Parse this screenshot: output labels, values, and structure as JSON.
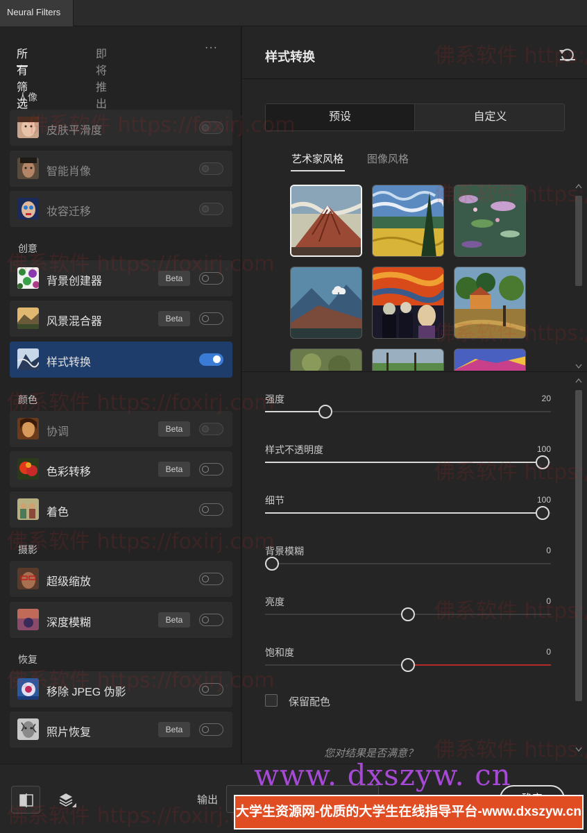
{
  "window": {
    "tab_title": "Neural Filters"
  },
  "left_panel": {
    "tabs": [
      {
        "label": "所有筛选器",
        "active": true
      },
      {
        "label": "即将推出",
        "active": false
      }
    ],
    "more": "···",
    "categories": [
      {
        "label": "人像",
        "filters": [
          {
            "name": "皮肤平滑度",
            "beta": false,
            "enabled": false,
            "available": false
          },
          {
            "name": "智能肖像",
            "beta": false,
            "enabled": false,
            "available": false
          },
          {
            "name": "妆容迁移",
            "beta": false,
            "enabled": false,
            "available": false
          }
        ]
      },
      {
        "label": "创意",
        "filters": [
          {
            "name": "背景创建器",
            "beta": true,
            "enabled": false,
            "available": true
          },
          {
            "name": "风景混合器",
            "beta": true,
            "enabled": false,
            "available": true
          },
          {
            "name": "样式转换",
            "beta": false,
            "enabled": true,
            "available": true,
            "selected": true
          }
        ]
      },
      {
        "label": "颜色",
        "filters": [
          {
            "name": "协调",
            "beta": true,
            "enabled": false,
            "available": false
          },
          {
            "name": "色彩转移",
            "beta": true,
            "enabled": false,
            "available": true
          },
          {
            "name": "着色",
            "beta": false,
            "enabled": false,
            "available": true
          }
        ]
      },
      {
        "label": "摄影",
        "filters": [
          {
            "name": "超级缩放",
            "beta": false,
            "enabled": false,
            "available": true
          },
          {
            "name": "深度模糊",
            "beta": true,
            "enabled": false,
            "available": true
          }
        ]
      },
      {
        "label": "恢复",
        "filters": [
          {
            "name": "移除 JPEG 伪影",
            "beta": false,
            "enabled": false,
            "available": true
          },
          {
            "name": "照片恢复",
            "beta": true,
            "enabled": false,
            "available": true
          }
        ]
      }
    ],
    "beta_label": "Beta"
  },
  "right_panel": {
    "title": "样式转换",
    "reset_icon": "reset-icon",
    "segment": {
      "preset": "预设",
      "custom": "自定义",
      "active": "preset"
    },
    "style_tabs": [
      {
        "label": "艺术家风格",
        "active": true
      },
      {
        "label": "图像风格",
        "active": false
      }
    ],
    "sliders": [
      {
        "label": "强度",
        "value": "20",
        "fraction": 0.21
      },
      {
        "label": "样式不透明度",
        "value": "100",
        "fraction": 0.97
      },
      {
        "label": "细节",
        "value": "100",
        "fraction": 0.97
      },
      {
        "label": "背景模糊",
        "value": "0",
        "fraction": 0.025
      },
      {
        "label": "亮度",
        "value": "0",
        "fraction": 0.5
      },
      {
        "label": "饱和度",
        "value": "0",
        "fraction": 0.5
      }
    ],
    "checkbox": {
      "label": "保留配色",
      "checked": false
    },
    "feedback": "您对结果是否满意？"
  },
  "bottom_bar": {
    "output_label": "输出",
    "ok_label": "确定"
  },
  "overlays": {
    "url_text": "www. dxszyw. cn",
    "banner_text": "大学生资源网-优质的大学生在线指导平台-www.dxszyw.cn",
    "watermark_text": "佛系软件 https://foxirj.com"
  },
  "colors": {
    "accent": "#3a7bd5",
    "selected_filter_bg": "#1f3d6b",
    "banner_bg": "#e04d22",
    "saturation_right": "#b52a2a"
  }
}
